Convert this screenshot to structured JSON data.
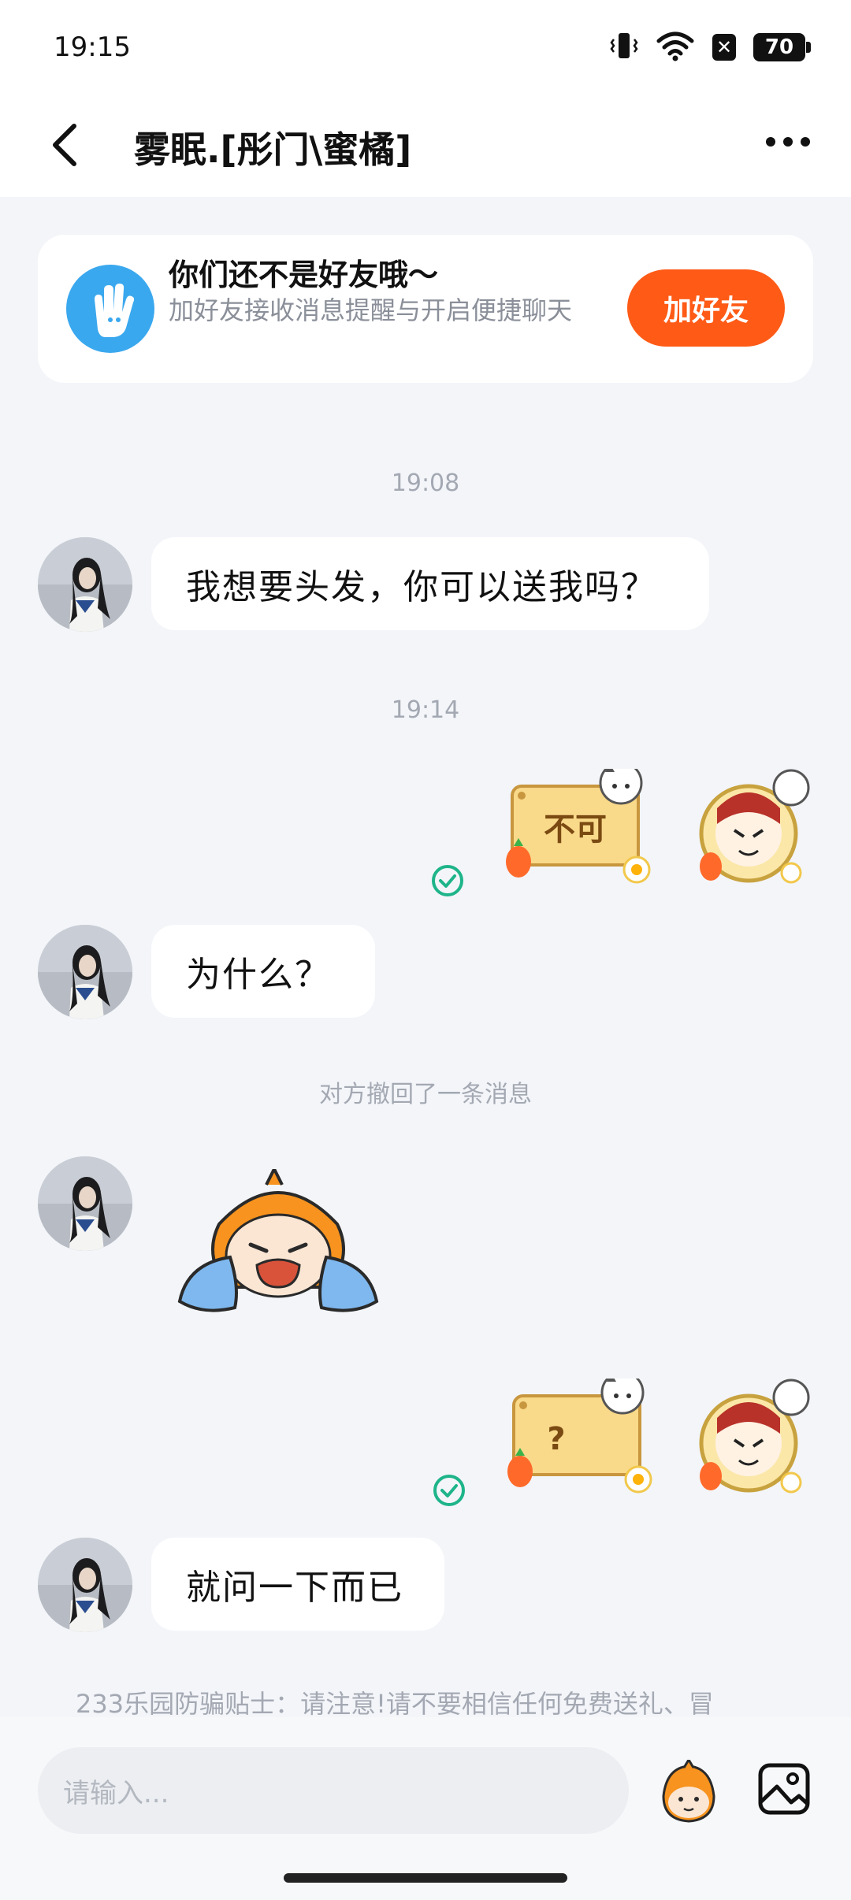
{
  "status_bar": {
    "time": "19:15",
    "battery": "70"
  },
  "header": {
    "title": "雾眠.[彤门\\蜜橘]"
  },
  "friend_card": {
    "title": "你们还不是好友哦～",
    "subtitle": "加好友接收消息提醒与开启便捷聊天",
    "button": "加好友"
  },
  "messages": {
    "time1": "19:08",
    "msg1": "我想要头发，你可以送我吗？",
    "time2": "19:14",
    "sticker1_text": "不可",
    "msg2": "为什么？",
    "recall_notice": "对方撤回了一条消息",
    "sticker2_text": "?",
    "msg3": "就问一下而已"
  },
  "notice": "233乐园防骗贴士：请注意!请不要相信任何免费送礼、冒",
  "input": {
    "placeholder": "请输入..."
  },
  "colors": {
    "accent": "#ff5a16",
    "friend_icon": "#3aa8ee",
    "check": "#1eb48a"
  }
}
